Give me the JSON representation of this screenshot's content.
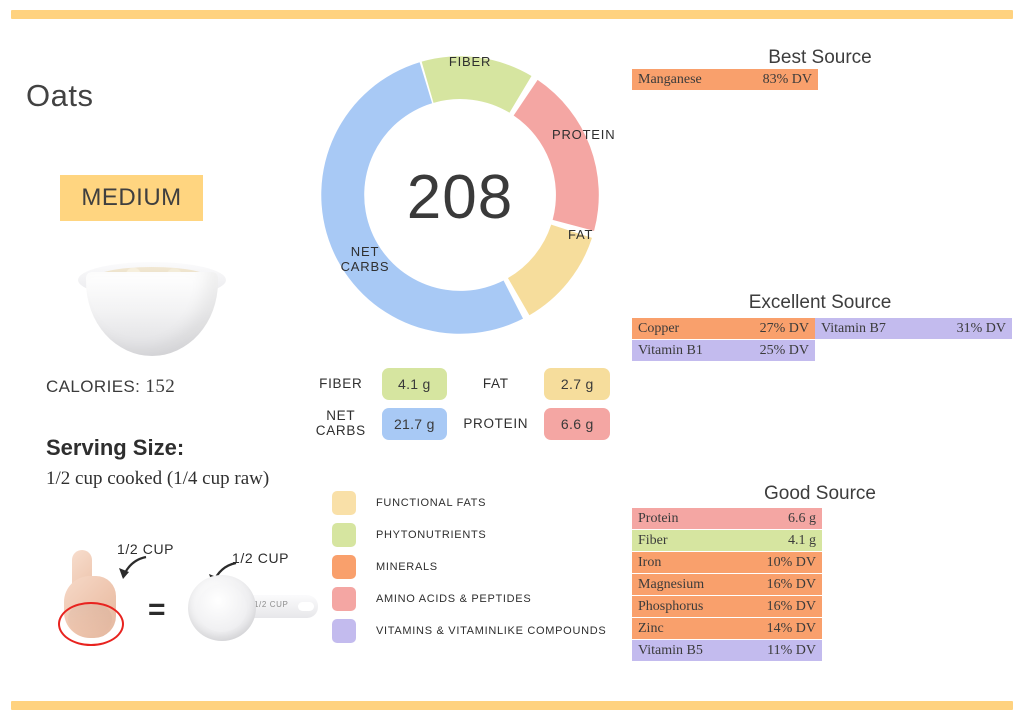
{
  "food": {
    "name": "Oats",
    "badge": "MEDIUM",
    "calories_label": "CALORIES:",
    "calories_value": "152",
    "serving_title": "Serving Size:",
    "serving_value": "1/2 cup cooked (1/4 cup raw)"
  },
  "equivalence": {
    "hand_label": "1/2 CUP",
    "cup_label": "1/2 CUP",
    "equals": "=",
    "cup_engraving": "1/2  CUP"
  },
  "donut": {
    "center_value": "208",
    "labels": {
      "fiber": "FIBER",
      "protein": "PROTEIN",
      "fat": "FAT",
      "net_carbs": "NET\nCARBS"
    }
  },
  "macros": [
    {
      "name": "FIBER",
      "value": "4.1 g",
      "color": "#d6e5a0"
    },
    {
      "name": "FAT",
      "value": "2.7 g",
      "color": "#f6dd9c"
    },
    {
      "name": "NET\nCARBS",
      "value": "21.7 g",
      "color": "#a8c9f5"
    },
    {
      "name": "PROTEIN",
      "value": "6.6 g",
      "color": "#f4a6a3"
    }
  ],
  "legend": [
    {
      "label": "FUNCTIONAL  FATS",
      "color": "#f9e0a8"
    },
    {
      "label": "PHYTONUTRIENTS",
      "color": "#d6e5a0"
    },
    {
      "label": "MINERALS",
      "color": "#f9a06c"
    },
    {
      "label": "AMINO ACIDS & PEPTIDES",
      "color": "#f4a6a3"
    },
    {
      "label": "VITAMINS & VITAMINLIKE COMPOUNDS",
      "color": "#c3bbee"
    }
  ],
  "sources": {
    "best": {
      "title": "Best Source",
      "items": [
        {
          "name": "Manganese",
          "value": "83% DV",
          "color": "#f9a06c"
        }
      ]
    },
    "excellent": {
      "title": "Excellent Source",
      "left": [
        {
          "name": "Copper",
          "value": "27% DV",
          "color": "#f9a06c"
        },
        {
          "name": "Vitamin B1",
          "value": "25% DV",
          "color": "#c3bbee"
        }
      ],
      "right": [
        {
          "name": "Vitamin B7",
          "value": "31% DV",
          "color": "#c3bbee"
        }
      ]
    },
    "good": {
      "title": "Good Source",
      "items": [
        {
          "name": "Protein",
          "value": "6.6 g",
          "color": "#f4a6a3"
        },
        {
          "name": "Fiber",
          "value": "4.1 g",
          "color": "#d6e5a0"
        },
        {
          "name": "Iron",
          "value": "10% DV",
          "color": "#f9a06c"
        },
        {
          "name": "Magnesium",
          "value": "16% DV",
          "color": "#f9a06c"
        },
        {
          "name": "Phosphorus",
          "value": "16% DV",
          "color": "#f9a06c"
        },
        {
          "name": "Zinc",
          "value": "14% DV",
          "color": "#f9a06c"
        },
        {
          "name": "Vitamin B5",
          "value": "11% DV",
          "color": "#c3bbee"
        }
      ]
    }
  },
  "chart_data": {
    "type": "pie",
    "title": "Calorie breakdown",
    "center_label": "208",
    "categories": [
      "FIBER",
      "PROTEIN",
      "FAT",
      "NET CARBS"
    ],
    "values": [
      4.1,
      6.6,
      2.7,
      21.7
    ],
    "units": "g",
    "percent_of_ring": [
      13.0,
      21.0,
      12.0,
      54.0
    ],
    "colors": [
      "#d6e5a0",
      "#f4a6a3",
      "#f6dd9c",
      "#a8c9f5"
    ],
    "legend_position": "labels-on-ring",
    "grid": false
  },
  "theme": {
    "rule_color": "#ffd27f",
    "badge_color": "#ffd580",
    "mineral": "#f9a06c",
    "vitamin": "#c3bbee",
    "protein": "#f4a6a3",
    "fiber": "#d6e5a0",
    "fat": "#f6dd9c",
    "carbs": "#a8c9f5"
  }
}
